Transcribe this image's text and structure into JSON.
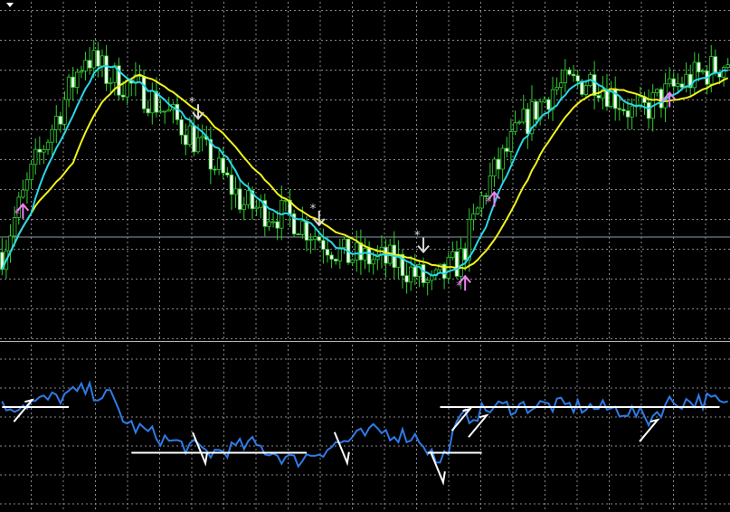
{
  "chart_data": [
    {
      "type": "candlestick",
      "panel": "main",
      "y_range": [
        0,
        100
      ],
      "grid": true,
      "colors": {
        "background": "#000000",
        "grid": "#8a8a8a",
        "candle": "#32cd32",
        "candle_body_bull": "#000000",
        "candle_body_bear": "#ffffff",
        "fast_ma": "#29d7e8",
        "slow_ma": "#f2f21a",
        "buy_arrow": "#ee82ee",
        "sell_arrow": "#d9d9d9",
        "horizontal_line": "#8c9aa8"
      },
      "horizontal_line": 30.5,
      "candles": [],
      "fast_ma": [],
      "slow_ma": [],
      "signals": [
        {
          "type": "buy",
          "bar": 5
        },
        {
          "type": "sell",
          "bar": 47
        },
        {
          "type": "sell",
          "bar": 76
        },
        {
          "type": "sell",
          "bar": 101
        },
        {
          "type": "buy",
          "bar": 111
        },
        {
          "type": "buy",
          "bar": 118
        },
        {
          "type": "buy",
          "bar": 160
        }
      ]
    },
    {
      "type": "line",
      "panel": "oscillator",
      "y_range": [
        0,
        100
      ],
      "grid": true,
      "colors": {
        "line": "#2e7be6",
        "level": "#ffffff",
        "marker": "#ffffff"
      },
      "series": [
        {
          "values": []
        }
      ],
      "levels": [
        {
          "from_bar": 0,
          "to_bar": 16,
          "value": 62
        },
        {
          "from_bar": 31,
          "to_bar": 73,
          "value": 35
        },
        {
          "from_bar": 102,
          "to_bar": 115,
          "value": 35
        },
        {
          "from_bar": 105,
          "to_bar": 172,
          "value": 62
        }
      ],
      "markers": [
        {
          "type": "up",
          "bar": 5
        },
        {
          "type": "down",
          "bar": 47
        },
        {
          "type": "down",
          "bar": 81
        },
        {
          "type": "down",
          "bar": 104
        },
        {
          "type": "up",
          "bar": 110
        },
        {
          "type": "up",
          "bar": 114
        },
        {
          "type": "up",
          "bar": 155
        }
      ]
    }
  ]
}
